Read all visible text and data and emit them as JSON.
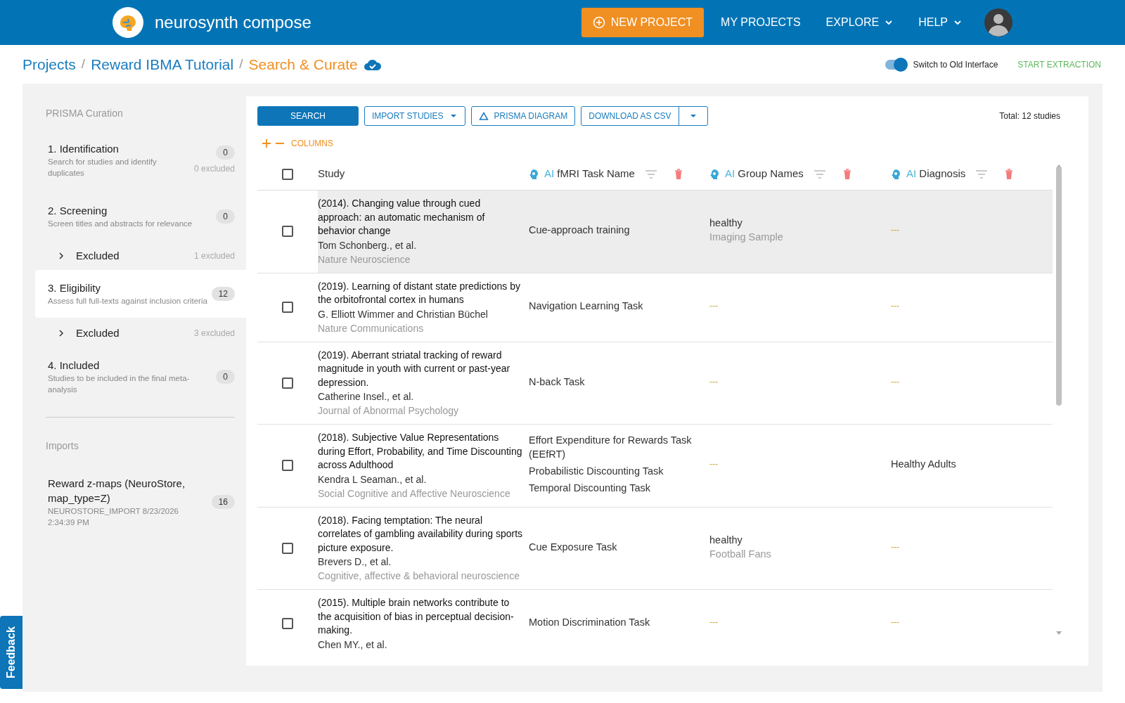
{
  "navbar": {
    "brand": "neurosynth compose",
    "items": [
      {
        "label": "NEW PROJECT",
        "kind": "primary"
      },
      {
        "label": "MY PROJECTS",
        "kind": "link"
      },
      {
        "label": "EXPLORE",
        "kind": "dropdown"
      },
      {
        "label": "HELP",
        "kind": "dropdown"
      }
    ]
  },
  "breadcrumb": [
    {
      "label": "Projects",
      "selected": false
    },
    {
      "separator": "/",
      "label": "Reward IBMA Tutorial",
      "selected": false
    },
    {
      "separator": "/",
      "label": "Search & Curate",
      "selected": true
    }
  ],
  "interface_switch": {
    "label": "Switch to Old Interface",
    "on": true
  },
  "start_extraction": "START EXTRACTION",
  "sidebar": {
    "title": "PRISMA Curation",
    "steps": [
      {
        "title": "1. Identification",
        "description": "Search for studies and identify duplicates",
        "count": "0",
        "excluded": "0 excluded",
        "selected": false
      },
      {
        "title": "2. Screening",
        "description": "Screen titles and abstracts for relevance",
        "count": "0",
        "selected": false,
        "excluded_group": {
          "label": "Excluded",
          "count": "1 excluded",
          "expanded": false
        }
      },
      {
        "title": "3. Eligibility",
        "description": "Assess full full-texts against inclusion criteria",
        "count": "12",
        "selected": true,
        "excluded_group": {
          "label": "Excluded",
          "count": "3 excluded",
          "expanded": false
        }
      },
      {
        "title": "4. Included",
        "description": "Studies to be included in the final meta-analysis",
        "count": "0",
        "selected": false
      }
    ],
    "imports_title": "Imports",
    "imports": [
      {
        "title": "Reward z-maps (NeuroStore, map_type=Z)",
        "detail": "NEUROSTORE_IMPORT 8/23/2026 2:34:39 PM",
        "count": "16"
      }
    ]
  },
  "toolbar": {
    "buttons": [
      {
        "label": "SEARCH",
        "kind": "primary"
      },
      {
        "label": "IMPORT STUDIES",
        "kind": "dropdown"
      },
      {
        "label": "PRISMA DIAGRAM",
        "kind": "icon"
      },
      {
        "label": "DOWNLOAD AS CSV",
        "kind": "split"
      }
    ],
    "total": "Total: 12 studies"
  },
  "columns_label": "COLUMNS",
  "table": {
    "select_all": {
      "checked": false
    },
    "columns": [
      {
        "label": "Study",
        "kind": "plain"
      },
      {
        "prefix": "AI",
        "label": "fMRI Task Name",
        "kind": "ai"
      },
      {
        "prefix": "AI",
        "label": "Group Names",
        "kind": "ai"
      },
      {
        "prefix": "AI",
        "label": "Diagnosis",
        "kind": "ai"
      }
    ],
    "rows": [
      {
        "checked": false,
        "hovered": true,
        "cells": [
          {
            "title": "(2014). Changing value through cued approach: an automatic mechanism of behavior change",
            "authors": "Tom Schonberg., et al.",
            "journal": "Nature Neuroscience"
          },
          {
            "lines": [
              {
                "text": "Cue-approach training",
                "kind": "value"
              }
            ]
          },
          {
            "lines": [
              {
                "text": "healthy",
                "kind": "value"
              },
              {
                "text": "Imaging Sample",
                "kind": "muted"
              }
            ]
          },
          {
            "lines": [
              {
                "text": "---",
                "kind": "empty"
              }
            ]
          }
        ]
      },
      {
        "checked": false,
        "hovered": false,
        "cells": [
          {
            "title": "(2019). Learning of distant state predictions by the orbitofrontal cortex in humans",
            "authors": "G. Elliott Wimmer and Christian Büchel",
            "journal": "Nature Communications"
          },
          {
            "lines": [
              {
                "text": "Navigation Learning Task",
                "kind": "value"
              }
            ]
          },
          {
            "lines": [
              {
                "text": "---",
                "kind": "empty"
              }
            ]
          },
          {
            "lines": [
              {
                "text": "---",
                "kind": "empty"
              }
            ]
          }
        ]
      },
      {
        "checked": false,
        "hovered": false,
        "cells": [
          {
            "title": "(2019). Aberrant striatal tracking of reward magnitude in youth with current or past-year depression.",
            "authors": "Catherine Insel., et al.",
            "journal": "Journal of Abnormal Psychology"
          },
          {
            "lines": [
              {
                "text": "N-back Task",
                "kind": "value"
              }
            ]
          },
          {
            "lines": [
              {
                "text": "---",
                "kind": "empty"
              }
            ]
          },
          {
            "lines": [
              {
                "text": "---",
                "kind": "empty"
              }
            ]
          }
        ]
      },
      {
        "checked": false,
        "hovered": false,
        "cells": [
          {
            "title": "(2018). Subjective Value Representations during Effort, Probability, and Time Discounting across Adulthood",
            "authors": "Kendra L Seaman., et al.",
            "journal": "Social Cognitive and Affective Neuroscience"
          },
          {
            "lines": [
              {
                "text": "Effort Expenditure for Rewards Task (EEfRT)",
                "kind": "value"
              },
              {
                "text": "Probabilistic Discounting Task",
                "kind": "value"
              },
              {
                "text": "Temporal Discounting Task",
                "kind": "value"
              }
            ]
          },
          {
            "lines": [
              {
                "text": "---",
                "kind": "empty"
              }
            ]
          },
          {
            "lines": [
              {
                "text": "Healthy Adults",
                "kind": "value"
              }
            ]
          }
        ]
      },
      {
        "checked": false,
        "hovered": false,
        "cells": [
          {
            "title": "(2018). Facing temptation: The neural correlates of gambling availability during sports picture exposure.",
            "authors": "Brevers D., et al.",
            "journal": "Cognitive, affective & behavioral neuroscience"
          },
          {
            "lines": [
              {
                "text": "Cue Exposure Task",
                "kind": "value"
              }
            ]
          },
          {
            "lines": [
              {
                "text": "healthy",
                "kind": "value"
              },
              {
                "text": "Football Fans",
                "kind": "muted"
              }
            ]
          },
          {
            "lines": [
              {
                "text": "---",
                "kind": "empty"
              }
            ]
          }
        ]
      },
      {
        "checked": false,
        "hovered": false,
        "cells": [
          {
            "title": "(2015). Multiple brain networks contribute to the acquisition of bias in perceptual decision-making.",
            "authors": "Chen MY., et al."
          },
          {
            "lines": [
              {
                "text": "Motion Discrimination Task",
                "kind": "value"
              }
            ]
          },
          {
            "lines": [
              {
                "text": "---",
                "kind": "empty"
              }
            ]
          },
          {
            "lines": [
              {
                "text": "---",
                "kind": "empty"
              }
            ]
          }
        ]
      }
    ]
  },
  "feedback_tab": "Feedback"
}
